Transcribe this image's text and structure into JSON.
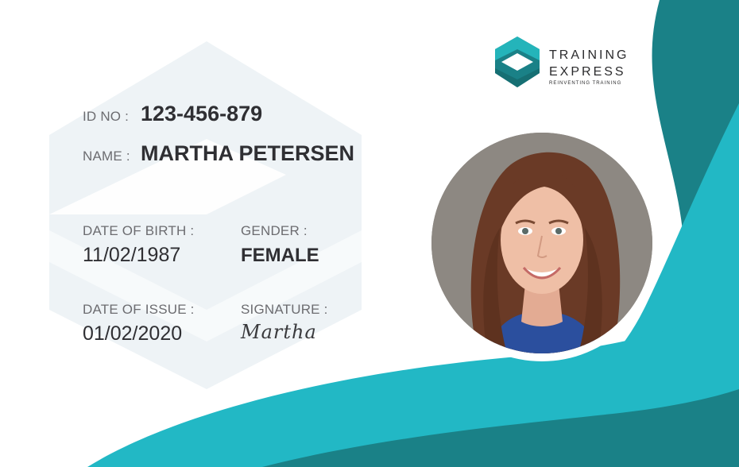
{
  "brand": {
    "line1": "TRAINING",
    "line2": "EXPRESS",
    "tagline": "REINVENTING TRAINING",
    "logo_icon": "hexagon-logo-icon"
  },
  "card": {
    "id_label": "ID NO :",
    "id_value": "123-456-879",
    "name_label": "NAME :",
    "name_value": "MARTHA PETERSEN",
    "dob_label": "DATE OF BIRTH :",
    "dob_value": "11/02/1987",
    "gender_label": "GENDER :",
    "gender_value": "FEMALE",
    "issue_label": "DATE OF ISSUE :",
    "issue_value": "01/02/2020",
    "signature_label": "SIGNATURE :",
    "signature_value": "Martha"
  },
  "colors": {
    "teal_light": "#22b8c5",
    "teal_dark": "#1a8187",
    "watermark": "#eef3f6",
    "text_dark": "#2f2f33",
    "text_label": "#6c6c70"
  }
}
